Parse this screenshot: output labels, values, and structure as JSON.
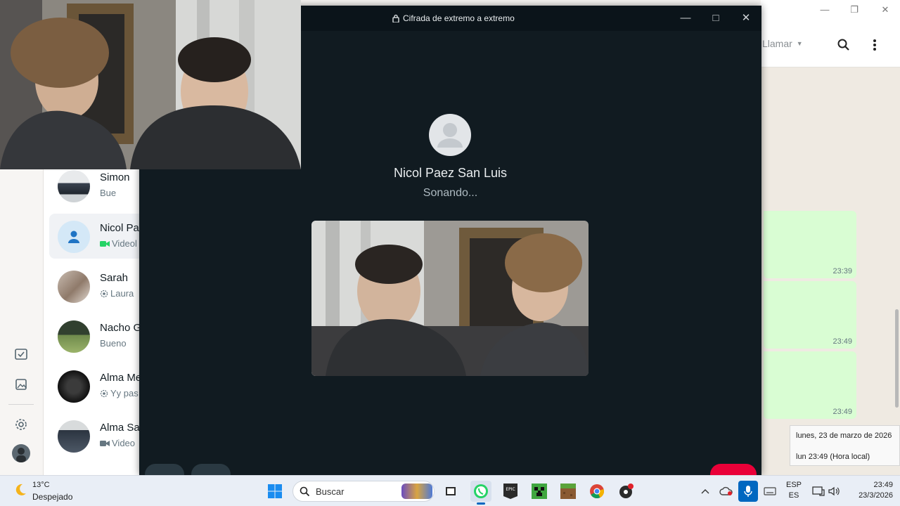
{
  "call": {
    "encrypted_label": "Cifrada de extremo a extremo",
    "callee_name": "Nicol Paez San Luis",
    "status": "Sonando..."
  },
  "chat_list": [
    {
      "name": "Simon",
      "snippet": "Bue",
      "snippet_icon": "none"
    },
    {
      "name": "Nicol Pa",
      "snippet": "Videol",
      "snippet_icon": "video-icon"
    },
    {
      "name": "Sarah",
      "snippet": "Laura",
      "snippet_icon": "status-icon"
    },
    {
      "name": "Nacho G",
      "snippet": "Bueno",
      "snippet_icon": "none"
    },
    {
      "name": "Alma Me",
      "snippet": "Yy pas",
      "snippet_icon": "status-icon"
    },
    {
      "name": "Alma Sa",
      "snippet": "Video",
      "snippet_icon": "video-icon"
    }
  ],
  "chat_header": {
    "call_button": "Llamar"
  },
  "messages": [
    {
      "time": "23:39"
    },
    {
      "time": "23:49"
    },
    {
      "time": "23:49"
    }
  ],
  "tooltip": {
    "date": "lunes, 23 de marzo de 2026",
    "time": "lun 23:49 (Hora local)"
  },
  "taskbar": {
    "weather_temp": "13°C",
    "weather_desc": "Despejado",
    "search_placeholder": "Buscar",
    "lang_top": "ESP",
    "lang_bottom": "ES",
    "clock_time": "23:49",
    "clock_date": "23/3/2026"
  },
  "colors": {
    "call_bg": "#111b21",
    "bubble_out": "#d9fdd3",
    "end_call_red": "#ea0038",
    "whatsapp_green": "#25d366"
  }
}
